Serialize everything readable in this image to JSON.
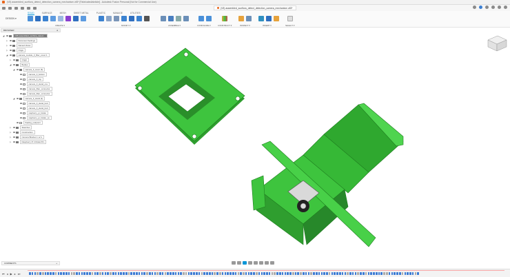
{
  "window": {
    "title": "(V5) assembled_sunflora_detect_detection_camera_mechanism v45* [Fabricated/ainticle] - Autodesk Fusion Personal (Not for Commercial Use)",
    "doc_tab": "(V5) assembled_sunflora_detect_detection_camera_mechanism v45*"
  },
  "toolbar": {
    "workspace": "DESIGN ▾",
    "tabs": [
      "SOLID",
      "SURFACE",
      "MESH",
      "SHEET METAL",
      "PLASTIC",
      "MANAGE",
      "UTILITIES"
    ],
    "active_tab": "SOLID",
    "groups": [
      "CREATE ▾",
      "MODIFY ▾",
      "ASSEMBLE ▾",
      "CONFIGURE ▾",
      "CONSTRUCT ▾",
      "INSPECT ▾",
      "INSERT ▾",
      "SELECT ▾"
    ]
  },
  "browser": {
    "title": "BROWSER",
    "items": [
      {
        "label": "(V5) assembled_sunflora_detect...",
        "level": 0,
        "exp": "open",
        "kind": "root"
      },
      {
        "label": "Document Settings",
        "level": 1,
        "exp": "closed",
        "kind": "gear"
      },
      {
        "label": "Named Views",
        "level": 1,
        "exp": "closed",
        "kind": "fold"
      },
      {
        "label": "Origin",
        "level": 1,
        "exp": "closed",
        "kind": "fold"
      },
      {
        "label": "camera_module_3_filter_cover:1",
        "level": 1,
        "exp": "open",
        "kind": "comp"
      },
      {
        "label": "Origin",
        "level": 2,
        "exp": "closed",
        "kind": "fold"
      },
      {
        "label": "Bodies",
        "level": 2,
        "exp": "open",
        "kind": "fold"
      },
      {
        "label": "camera_3_cover (5)",
        "level": 3,
        "exp": "open",
        "kind": "fold"
      },
      {
        "label": "camera_3_bottom",
        "level": 4,
        "exp": "",
        "kind": "body"
      },
      {
        "label": "camera_3_top",
        "level": 4,
        "exp": "",
        "kind": "body"
      },
      {
        "label": "camera_3_stand_cov",
        "level": 4,
        "exp": "",
        "kind": "body"
      },
      {
        "label": "camera_filter_connector",
        "level": 4,
        "exp": "",
        "kind": "body"
      },
      {
        "label": "camera_filter_connector",
        "level": 4,
        "exp": "",
        "kind": "body"
      },
      {
        "label": "camera_3_stand (4)",
        "level": 3,
        "exp": "open",
        "kind": "fold"
      },
      {
        "label": "camera_3_stand_bott",
        "level": 4,
        "exp": "",
        "kind": "body"
      },
      {
        "label": "camera_3_stand_bott",
        "level": 4,
        "exp": "",
        "kind": "body"
      },
      {
        "label": "raspberry_pi_holder",
        "level": 4,
        "exp": "",
        "kind": "body"
      },
      {
        "label": "raspberry_pi_holder_co",
        "level": 4,
        "exp": "",
        "kind": "body"
      },
      {
        "label": "floating_endpoint",
        "level": 3,
        "exp": "",
        "kind": "body"
      },
      {
        "label": "Sketches",
        "level": 2,
        "exp": "closed",
        "kind": "fold"
      },
      {
        "label": "Construction",
        "level": 2,
        "exp": "closed",
        "kind": "fold"
      },
      {
        "label": "Camera Bracket 1 v2:1",
        "level": 2,
        "exp": "closed",
        "kind": "link"
      },
      {
        "label": "Raspberry Pi 4 Model B:1",
        "level": 2,
        "exp": "closed",
        "kind": "link"
      }
    ]
  },
  "comments": {
    "label": "COMMENTS",
    "add": "+"
  },
  "colors": {
    "part": "#3ec43e",
    "part_dark": "#1f7d1f",
    "accent": "#0696d7"
  }
}
